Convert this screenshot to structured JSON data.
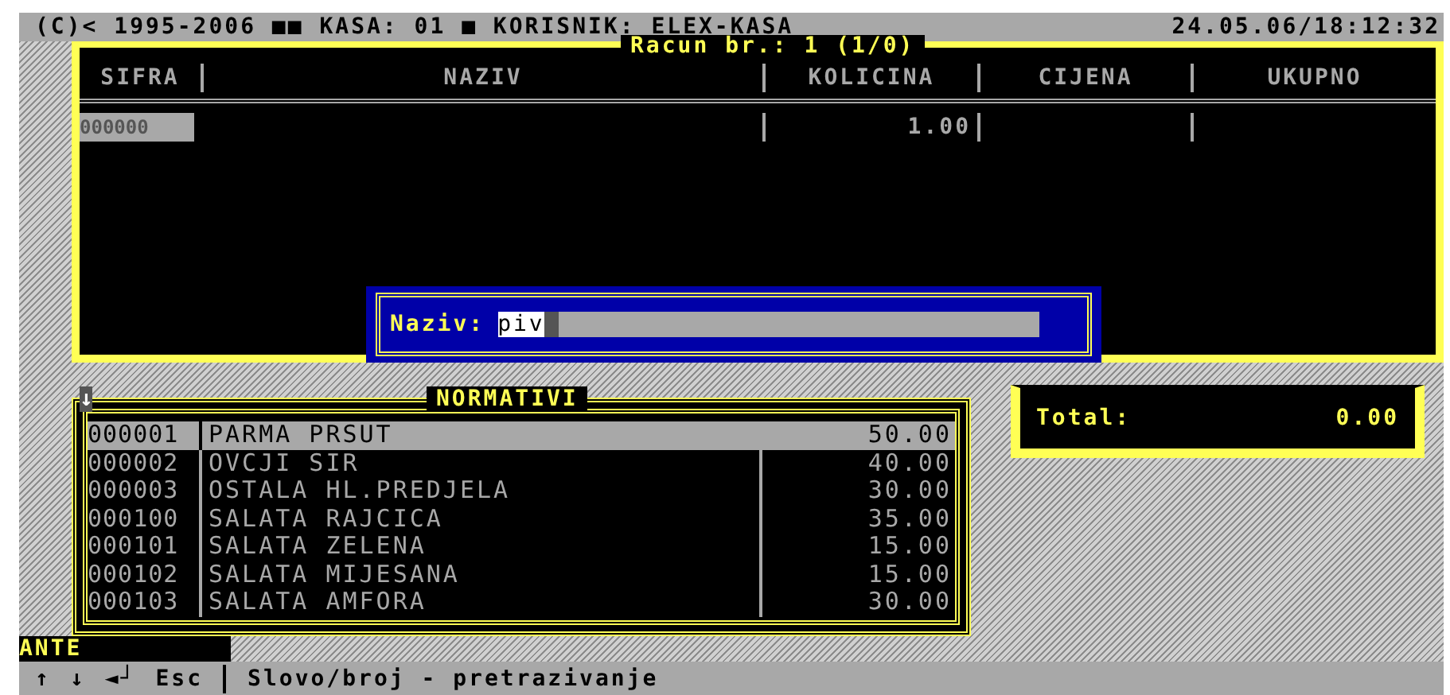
{
  "status_bar": {
    "left": "(C)< 1995-2006 ■■ KASA: 01 ■ KORISNIK: ELEX-KASA",
    "datetime": "24.05.06/18:12:32"
  },
  "receipt": {
    "title": "Racun br.: 1 (1/0)",
    "columns": [
      "SIFRA",
      "NAZIV",
      "KOLICINA",
      "CIJENA",
      "UKUPNO"
    ],
    "rows": [
      {
        "sifra": "000000",
        "kolicina": "1.00",
        "selected": true
      }
    ]
  },
  "search_dialog": {
    "label": "Naziv:",
    "value": "piv"
  },
  "normativi": {
    "title": "NORMATIVI",
    "scroll_indicator": "↓",
    "rows": [
      {
        "code": "000001",
        "name": "PARMA PRSUT",
        "price": "50.00",
        "selected": true
      },
      {
        "code": "000002",
        "name": "OVCJI SIR",
        "price": "40.00",
        "selected": false
      },
      {
        "code": "000003",
        "name": "OSTALA HL.PREDJELA",
        "price": "30.00",
        "selected": false
      },
      {
        "code": "000100",
        "name": "SALATA RAJCICA",
        "price": "35.00",
        "selected": false
      },
      {
        "code": "000101",
        "name": "SALATA ZELENA",
        "price": "15.00",
        "selected": false
      },
      {
        "code": "000102",
        "name": "SALATA MIJESANA",
        "price": "15.00",
        "selected": false
      },
      {
        "code": "000103",
        "name": "SALATA AMFORA",
        "price": "30.00",
        "selected": false
      }
    ]
  },
  "total": {
    "label": "Total:",
    "value": "0.00"
  },
  "user": "ANTE",
  "key_bar": {
    "keys": [
      "↑",
      "↓",
      "◄┘",
      "Esc"
    ],
    "hint": "Slovo/broj - pretrazivanje"
  }
}
